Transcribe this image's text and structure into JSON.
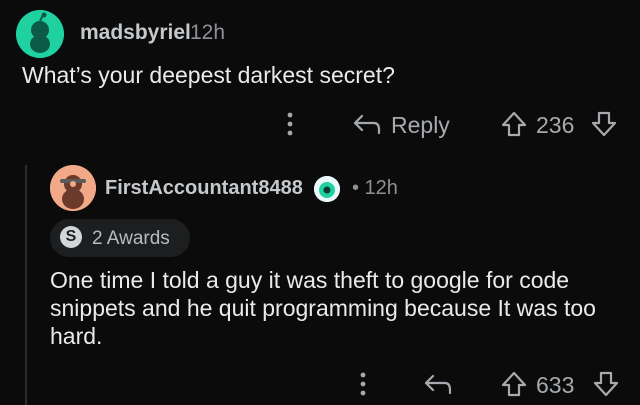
{
  "top_comment": {
    "username": "madsbyriel",
    "time": "12h",
    "text": "What’s your deepest darkest secret?",
    "reply_label": "Reply",
    "score": "236",
    "avatar_color": "#1fd1a0"
  },
  "reply_comment": {
    "username": "FirstAccountant8488",
    "time": "• 12h",
    "awards_label": "2 Awards",
    "award_icon_letter": "S",
    "text": "One time I told a guy it was theft to google for code snippets and he quit programming because It was too hard.",
    "score": "633",
    "avatar_color": "#f1a988"
  },
  "icons": [
    "more-icon",
    "reply-icon",
    "upvote-icon",
    "downvote-icon",
    "avatar-icon",
    "award-icon"
  ],
  "colors": {
    "background": "#0b0b0b",
    "text": "#e8eaec",
    "muted": "#8d9196"
  }
}
